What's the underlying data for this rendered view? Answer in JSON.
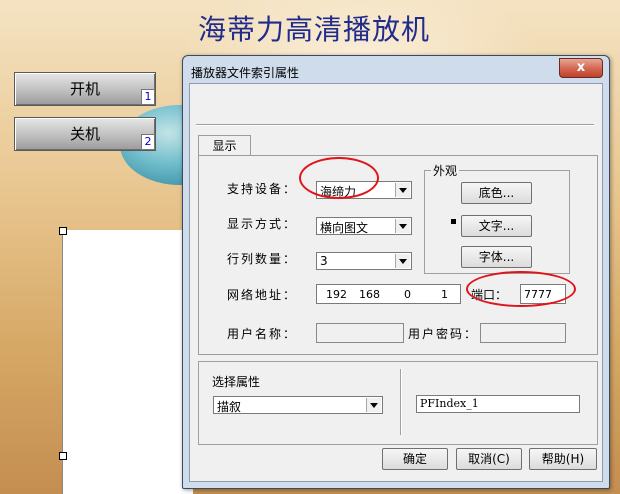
{
  "app": {
    "title": "海蒂力高清播放机",
    "buttons": [
      {
        "label": "开机",
        "index": "1"
      },
      {
        "label": "关机",
        "index": "2"
      }
    ]
  },
  "dialog": {
    "title": "播放器文件索引属性",
    "close_label": "x",
    "tab": "显示",
    "rows": {
      "device_label": "支持设备：",
      "device_value": "海缔力",
      "display_label": "显示方式：",
      "display_value": "横向图文",
      "rows_label": "行列数量：",
      "rows_value": "3",
      "network_label": "网络地址：",
      "ip": [
        "192",
        "168",
        "0",
        "1"
      ],
      "port_label": "端口：",
      "port_value": "7777",
      "user_label": "用户名称：",
      "user_value": "",
      "password_label": "用户密码：",
      "password_value": ""
    },
    "appearance": {
      "title": "外观",
      "bg_color": "底色...",
      "text": "文字...",
      "font": "字体..."
    },
    "select_property": {
      "label": "选择属性",
      "value": "描叙",
      "field_value": "PFIndex_1"
    },
    "footer": {
      "ok": "确定",
      "cancel": "取消(C)",
      "help": "帮助(H)"
    }
  },
  "colors": {
    "title": "#1f2c8c",
    "highlight_ring": "#e0141b"
  }
}
